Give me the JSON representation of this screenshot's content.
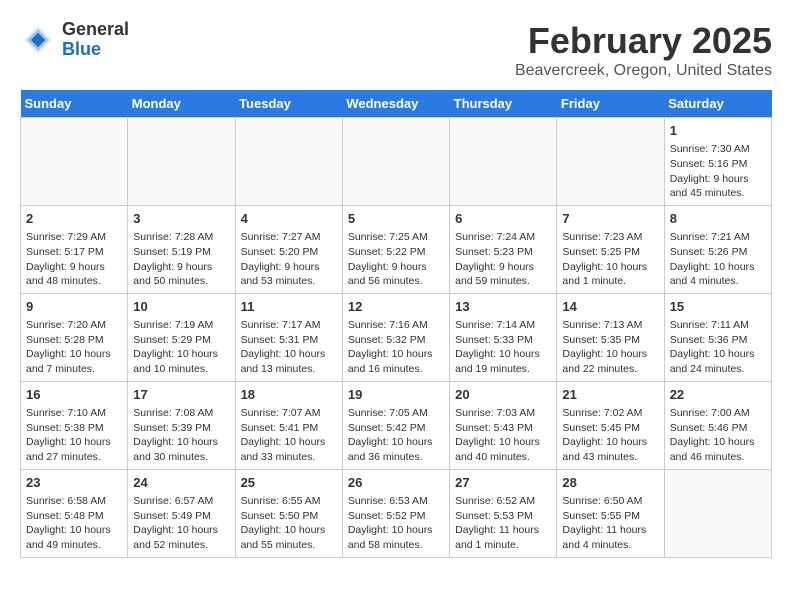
{
  "header": {
    "logo_general": "General",
    "logo_blue": "Blue",
    "title": "February 2025",
    "subtitle": "Beavercreek, Oregon, United States"
  },
  "days_of_week": [
    "Sunday",
    "Monday",
    "Tuesday",
    "Wednesday",
    "Thursday",
    "Friday",
    "Saturday"
  ],
  "weeks": [
    [
      {
        "day": "",
        "info": ""
      },
      {
        "day": "",
        "info": ""
      },
      {
        "day": "",
        "info": ""
      },
      {
        "day": "",
        "info": ""
      },
      {
        "day": "",
        "info": ""
      },
      {
        "day": "",
        "info": ""
      },
      {
        "day": "1",
        "info": "Sunrise: 7:30 AM\nSunset: 5:16 PM\nDaylight: 9 hours and 45 minutes."
      }
    ],
    [
      {
        "day": "2",
        "info": "Sunrise: 7:29 AM\nSunset: 5:17 PM\nDaylight: 9 hours and 48 minutes."
      },
      {
        "day": "3",
        "info": "Sunrise: 7:28 AM\nSunset: 5:19 PM\nDaylight: 9 hours and 50 minutes."
      },
      {
        "day": "4",
        "info": "Sunrise: 7:27 AM\nSunset: 5:20 PM\nDaylight: 9 hours and 53 minutes."
      },
      {
        "day": "5",
        "info": "Sunrise: 7:25 AM\nSunset: 5:22 PM\nDaylight: 9 hours and 56 minutes."
      },
      {
        "day": "6",
        "info": "Sunrise: 7:24 AM\nSunset: 5:23 PM\nDaylight: 9 hours and 59 minutes."
      },
      {
        "day": "7",
        "info": "Sunrise: 7:23 AM\nSunset: 5:25 PM\nDaylight: 10 hours and 1 minute."
      },
      {
        "day": "8",
        "info": "Sunrise: 7:21 AM\nSunset: 5:26 PM\nDaylight: 10 hours and 4 minutes."
      }
    ],
    [
      {
        "day": "9",
        "info": "Sunrise: 7:20 AM\nSunset: 5:28 PM\nDaylight: 10 hours and 7 minutes."
      },
      {
        "day": "10",
        "info": "Sunrise: 7:19 AM\nSunset: 5:29 PM\nDaylight: 10 hours and 10 minutes."
      },
      {
        "day": "11",
        "info": "Sunrise: 7:17 AM\nSunset: 5:31 PM\nDaylight: 10 hours and 13 minutes."
      },
      {
        "day": "12",
        "info": "Sunrise: 7:16 AM\nSunset: 5:32 PM\nDaylight: 10 hours and 16 minutes."
      },
      {
        "day": "13",
        "info": "Sunrise: 7:14 AM\nSunset: 5:33 PM\nDaylight: 10 hours and 19 minutes."
      },
      {
        "day": "14",
        "info": "Sunrise: 7:13 AM\nSunset: 5:35 PM\nDaylight: 10 hours and 22 minutes."
      },
      {
        "day": "15",
        "info": "Sunrise: 7:11 AM\nSunset: 5:36 PM\nDaylight: 10 hours and 24 minutes."
      }
    ],
    [
      {
        "day": "16",
        "info": "Sunrise: 7:10 AM\nSunset: 5:38 PM\nDaylight: 10 hours and 27 minutes."
      },
      {
        "day": "17",
        "info": "Sunrise: 7:08 AM\nSunset: 5:39 PM\nDaylight: 10 hours and 30 minutes."
      },
      {
        "day": "18",
        "info": "Sunrise: 7:07 AM\nSunset: 5:41 PM\nDaylight: 10 hours and 33 minutes."
      },
      {
        "day": "19",
        "info": "Sunrise: 7:05 AM\nSunset: 5:42 PM\nDaylight: 10 hours and 36 minutes."
      },
      {
        "day": "20",
        "info": "Sunrise: 7:03 AM\nSunset: 5:43 PM\nDaylight: 10 hours and 40 minutes."
      },
      {
        "day": "21",
        "info": "Sunrise: 7:02 AM\nSunset: 5:45 PM\nDaylight: 10 hours and 43 minutes."
      },
      {
        "day": "22",
        "info": "Sunrise: 7:00 AM\nSunset: 5:46 PM\nDaylight: 10 hours and 46 minutes."
      }
    ],
    [
      {
        "day": "23",
        "info": "Sunrise: 6:58 AM\nSunset: 5:48 PM\nDaylight: 10 hours and 49 minutes."
      },
      {
        "day": "24",
        "info": "Sunrise: 6:57 AM\nSunset: 5:49 PM\nDaylight: 10 hours and 52 minutes."
      },
      {
        "day": "25",
        "info": "Sunrise: 6:55 AM\nSunset: 5:50 PM\nDaylight: 10 hours and 55 minutes."
      },
      {
        "day": "26",
        "info": "Sunrise: 6:53 AM\nSunset: 5:52 PM\nDaylight: 10 hours and 58 minutes."
      },
      {
        "day": "27",
        "info": "Sunrise: 6:52 AM\nSunset: 5:53 PM\nDaylight: 11 hours and 1 minute."
      },
      {
        "day": "28",
        "info": "Sunrise: 6:50 AM\nSunset: 5:55 PM\nDaylight: 11 hours and 4 minutes."
      },
      {
        "day": "",
        "info": ""
      }
    ]
  ]
}
